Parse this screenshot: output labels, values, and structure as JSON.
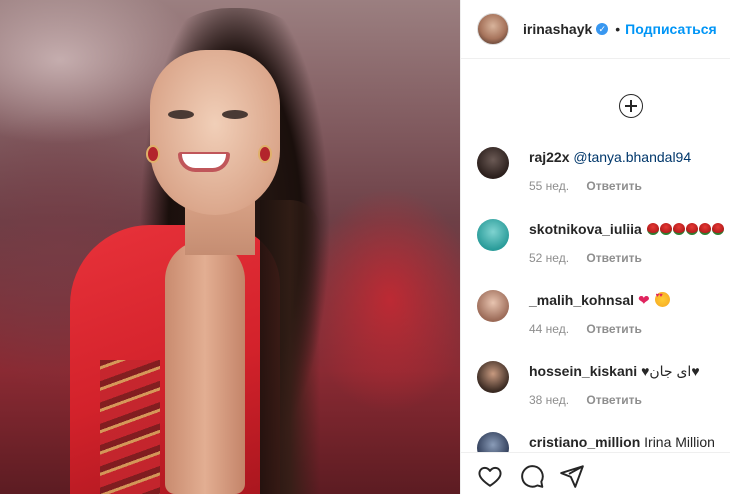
{
  "post": {
    "image_alt": "Post photo"
  },
  "header": {
    "username": "irinashayk",
    "verified_mark": "✓",
    "separator": "•",
    "follow_label": "Подписаться"
  },
  "comments": [
    {
      "username": "raj22x",
      "mention": "@tanya.bhandal94",
      "text": "",
      "age": "55 нед.",
      "reply_label": "Ответить"
    },
    {
      "username": "skotnikova_iuliia",
      "mention": "",
      "text": "",
      "emoji": [
        "rose",
        "rose",
        "rose",
        "rose",
        "rose",
        "rose"
      ],
      "age": "52 нед.",
      "reply_label": "Ответить"
    },
    {
      "username": "_malih_kohnsal",
      "mention": "",
      "text": "",
      "emoji": [
        "heart",
        "heart-eyes"
      ],
      "age": "44 нед.",
      "reply_label": "Ответить"
    },
    {
      "username": "hossein_kiskani",
      "mention": "",
      "text": "♥ای جان♥",
      "age": "38 нед.",
      "reply_label": "Ответить"
    },
    {
      "username": "cristiano_million",
      "mention": "",
      "text": "Irina Million",
      "age": "",
      "reply_label": ""
    }
  ],
  "actions": {
    "like_icon": "heart-icon",
    "comment_icon": "comment-icon",
    "share_icon": "share-icon"
  },
  "colors": {
    "link": "#0095f6",
    "mention": "#00376b",
    "meta": "#8e8e8e",
    "verified": "#3897f0"
  }
}
